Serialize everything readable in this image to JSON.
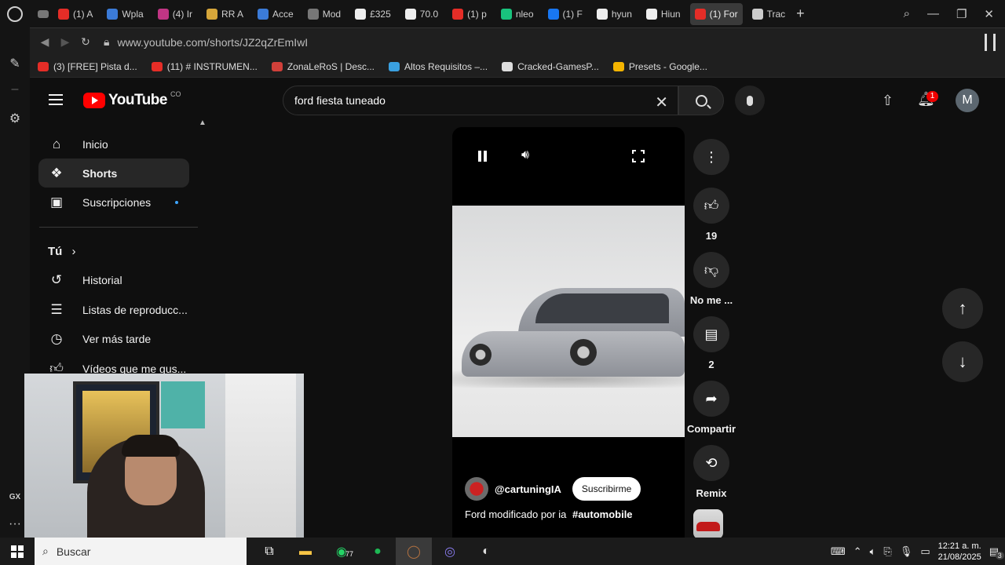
{
  "tabs": [
    {
      "label": "(1) A",
      "color": "#e52d27"
    },
    {
      "label": "Wpla",
      "color": "#3b7bd8"
    },
    {
      "label": "(4) Ir",
      "color": "#c13584"
    },
    {
      "label": "RR A",
      "color": "#d6a63a"
    },
    {
      "label": "Acce",
      "color": "#3b7bd8"
    },
    {
      "label": "Mod",
      "color": "#777777"
    },
    {
      "label": "£325",
      "color": "#eeeeee"
    },
    {
      "label": "70.0",
      "color": "#eeeeee"
    },
    {
      "label": "(1) p",
      "color": "#e52d27"
    },
    {
      "label": "nleo",
      "color": "#19c37d"
    },
    {
      "label": "(1) F",
      "color": "#1877f2"
    },
    {
      "label": "hyun",
      "color": "#eeeeee"
    },
    {
      "label": "Hiun",
      "color": "#eeeeee"
    },
    {
      "label": "(1) For",
      "color": "#e52d27",
      "active": true
    },
    {
      "label": "Trac",
      "color": "#cccccc"
    }
  ],
  "address": {
    "url": "www.youtube.com/shorts/JZ2qZrEmIwI"
  },
  "bookmarks": [
    {
      "label": "(3) [FREE] Pista d...",
      "color": "#e52d27"
    },
    {
      "label": "(11) # INSTRUMEN...",
      "color": "#e52d27"
    },
    {
      "label": "ZonaLeRoS | Desc...",
      "color": "#d0403a"
    },
    {
      "label": "Altos Requisitos –...",
      "color": "#3aa0e0"
    },
    {
      "label": "Cracked-GamesP...",
      "color": "#dddddd"
    },
    {
      "label": "Presets - Google...",
      "color": "#f4b400"
    }
  ],
  "youtube": {
    "logo": "YouTube",
    "country": "CO",
    "search_value": "ford fiesta tuneado",
    "notif_count": "1",
    "avatar_letter": "M"
  },
  "sidebar": {
    "items": [
      {
        "label": "Inicio",
        "icon": "home-icon"
      },
      {
        "label": "Shorts",
        "icon": "shorts-icon"
      },
      {
        "label": "Suscripciones",
        "icon": "subscriptions-icon"
      }
    ],
    "you_label": "Tú",
    "you_items": [
      {
        "label": "Historial",
        "icon": "history-icon"
      },
      {
        "label": "Listas de reproducc...",
        "icon": "playlist-icon"
      },
      {
        "label": "Ver más tarde",
        "icon": "clock-icon"
      },
      {
        "label": "Vídeos que me gus...",
        "icon": "like-icon"
      }
    ]
  },
  "short": {
    "channel": "@cartuningIA",
    "subscribe": "Suscribirme",
    "caption": "Ford modificado por ia",
    "hashtag": "#automobile"
  },
  "actions": {
    "likes": "19",
    "dislike": "No me ...",
    "comments": "2",
    "share": "Compartir",
    "remix": "Remix"
  },
  "taskbar": {
    "search_placeholder": "Buscar",
    "whatsapp_badge": "77",
    "time": "12:21 a. m.",
    "date": "21/08/2025",
    "notif": "3"
  },
  "opera_side": {
    "gx": "GX"
  }
}
